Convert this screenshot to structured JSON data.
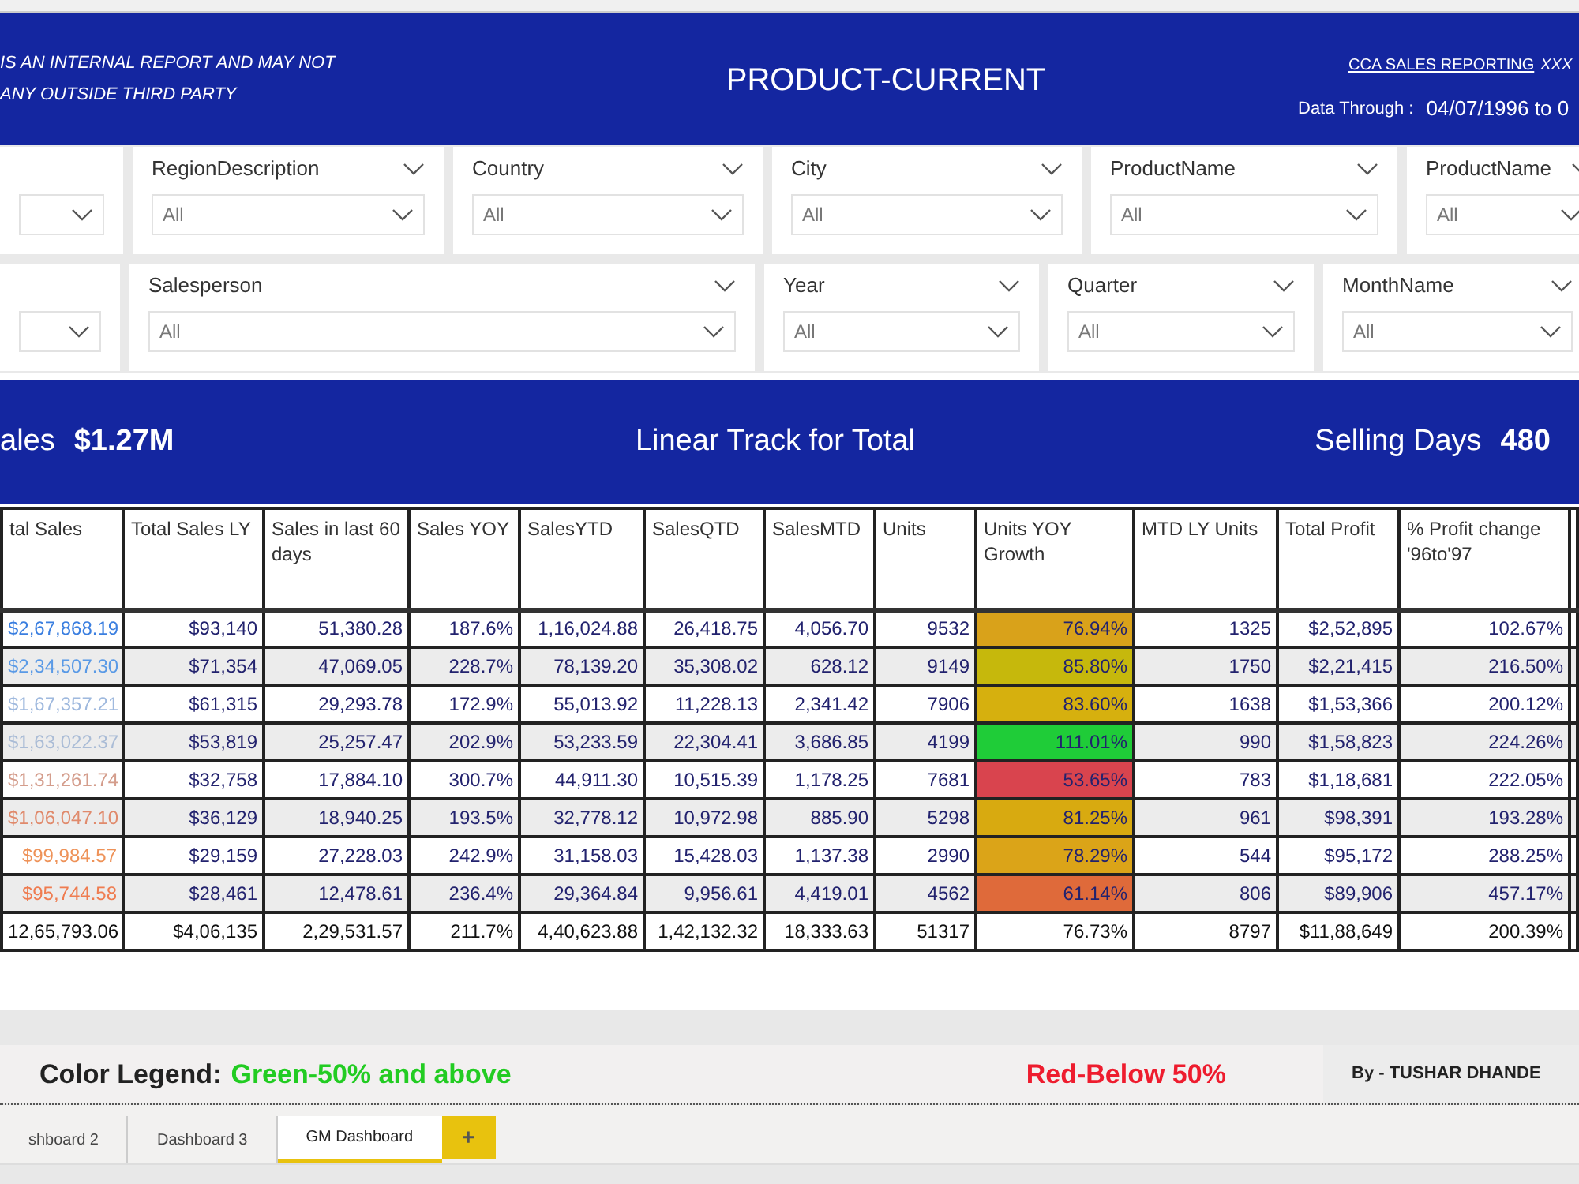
{
  "header": {
    "notice_lines": [
      "IS AN INTERNAL REPORT AND MAY NOT",
      "ANY OUTSIDE THIRD PARTY"
    ],
    "title": "PRODUCT-CURRENT",
    "link": "CCA SALES REPORTING",
    "link_suffix": "XXX",
    "data_through_label": "Data Through :",
    "data_through_value": "04/07/1996 to 0"
  },
  "filter_rows": [
    [
      {},
      {
        "label": "RegionDescription",
        "value": "All"
      },
      {
        "label": "Country",
        "value": "All"
      },
      {
        "label": "City",
        "value": "All"
      },
      {
        "label": "ProductName",
        "value": "All"
      },
      {
        "label": "ProductName",
        "value": "All"
      }
    ],
    [
      {},
      {
        "label": "Salesperson",
        "value": "All"
      },
      {
        "label": "Year",
        "value": "All"
      },
      {
        "label": "Quarter",
        "value": "All"
      },
      {
        "label": "MonthName",
        "value": "All"
      }
    ]
  ],
  "banner": {
    "left_label": "ales",
    "left_value": "$1.27M",
    "center": "Linear Track for Total",
    "right_label": "Selling Days",
    "right_value": "480"
  },
  "table": {
    "columns": [
      "tal Sales",
      "Total Sales LY",
      "Sales in last 60 days",
      "Sales YOY",
      "SalesYTD",
      "SalesQTD",
      "SalesMTD",
      "Units",
      "Units YOY Growth",
      "MTD LY Units",
      "Total Profit",
      "% Profit change '96to'97"
    ],
    "rows": [
      {
        "cells": [
          {
            "text": "$2,67,868.19",
            "color": "#3b7fe0"
          },
          {
            "text": "$93,140"
          },
          {
            "text": "51,380.28"
          },
          {
            "text": "187.6%"
          },
          {
            "text": "1,16,024.88"
          },
          {
            "text": "26,418.75"
          },
          {
            "text": "4,056.70"
          },
          {
            "text": "9532"
          },
          {
            "text": "76.94%",
            "color": "#d9a21a"
          },
          {
            "text": "1325"
          },
          {
            "text": "$2,52,895"
          },
          {
            "text": "102.67%"
          }
        ]
      },
      {
        "cells": [
          {
            "text": "$2,34,507.30",
            "color": "#5a9ae6"
          },
          {
            "text": "$71,354"
          },
          {
            "text": "47,069.05"
          },
          {
            "text": "228.7%"
          },
          {
            "text": "78,139.20"
          },
          {
            "text": "35,308.02"
          },
          {
            "text": "628.12"
          },
          {
            "text": "9149"
          },
          {
            "text": "85.80%",
            "color": "#c6b80c"
          },
          {
            "text": "1750"
          },
          {
            "text": "$2,21,415"
          },
          {
            "text": "216.50%"
          }
        ]
      },
      {
        "cells": [
          {
            "text": "$1,67,357.21",
            "color": "#9fb9de"
          },
          {
            "text": "$61,315"
          },
          {
            "text": "29,293.78"
          },
          {
            "text": "172.9%"
          },
          {
            "text": "55,013.92"
          },
          {
            "text": "11,228.13"
          },
          {
            "text": "2,341.42"
          },
          {
            "text": "7906"
          },
          {
            "text": "83.60%",
            "color": "#d6b00e"
          },
          {
            "text": "1638"
          },
          {
            "text": "$1,53,366"
          },
          {
            "text": "200.12%"
          }
        ]
      },
      {
        "cells": [
          {
            "text": "$1,63,022.37",
            "color": "#aabcd6"
          },
          {
            "text": "$53,819"
          },
          {
            "text": "25,257.47"
          },
          {
            "text": "202.9%"
          },
          {
            "text": "53,233.59"
          },
          {
            "text": "22,304.41"
          },
          {
            "text": "3,686.85"
          },
          {
            "text": "4199"
          },
          {
            "text": "111.01%",
            "color": "#1fcc38"
          },
          {
            "text": "990"
          },
          {
            "text": "$1,58,823"
          },
          {
            "text": "224.26%"
          }
        ]
      },
      {
        "cells": [
          {
            "text": "$1,31,261.74",
            "color": "#d49d8c"
          },
          {
            "text": "$32,758"
          },
          {
            "text": "17,884.10"
          },
          {
            "text": "300.7%"
          },
          {
            "text": "44,911.30"
          },
          {
            "text": "10,515.39"
          },
          {
            "text": "1,178.25"
          },
          {
            "text": "7681"
          },
          {
            "text": "53.65%",
            "color": "#d9444e"
          },
          {
            "text": "783"
          },
          {
            "text": "$1,18,681"
          },
          {
            "text": "222.05%"
          }
        ]
      },
      {
        "cells": [
          {
            "text": "$1,06,047.10",
            "color": "#e08a6c"
          },
          {
            "text": "$36,129"
          },
          {
            "text": "18,940.25"
          },
          {
            "text": "193.5%"
          },
          {
            "text": "32,778.12"
          },
          {
            "text": "10,972.98"
          },
          {
            "text": "885.90"
          },
          {
            "text": "5298"
          },
          {
            "text": "81.25%",
            "color": "#d8aa10"
          },
          {
            "text": "961"
          },
          {
            "text": "$98,391"
          },
          {
            "text": "193.28%"
          }
        ]
      },
      {
        "cells": [
          {
            "text": "$99,984.57",
            "color": "#ee9258"
          },
          {
            "text": "$29,159"
          },
          {
            "text": "27,228.03"
          },
          {
            "text": "242.9%"
          },
          {
            "text": "31,158.03"
          },
          {
            "text": "15,428.03"
          },
          {
            "text": "1,137.38"
          },
          {
            "text": "2990"
          },
          {
            "text": "78.29%",
            "color": "#dba418"
          },
          {
            "text": "544"
          },
          {
            "text": "$95,172"
          },
          {
            "text": "288.25%"
          }
        ]
      },
      {
        "cells": [
          {
            "text": "$95,744.58",
            "color": "#ef7c50"
          },
          {
            "text": "$28,461"
          },
          {
            "text": "12,478.61"
          },
          {
            "text": "236.4%"
          },
          {
            "text": "29,364.84"
          },
          {
            "text": "9,956.61"
          },
          {
            "text": "4,419.01"
          },
          {
            "text": "4562"
          },
          {
            "text": "61.14%",
            "color": "#df6a3a"
          },
          {
            "text": "806"
          },
          {
            "text": "$89,906"
          },
          {
            "text": "457.17%"
          }
        ]
      }
    ],
    "total": [
      "12,65,793.06",
      "$4,06,135",
      "2,29,531.57",
      "211.7%",
      "4,40,623.88",
      "1,42,132.32",
      "18,333.63",
      "51317",
      "76.73%",
      "8797",
      "$11,88,649",
      "200.39%"
    ]
  },
  "legend": {
    "label": "Color Legend:",
    "green": "Green-50% and above",
    "red": "Red-Below 50%",
    "author": "By - TUSHAR DHANDE"
  },
  "tabs": [
    {
      "label": "shboard 2",
      "selected": false
    },
    {
      "label": "Dashboard 3",
      "selected": false
    },
    {
      "label": "GM Dashboard",
      "selected": true
    }
  ],
  "add_tab": "+"
}
